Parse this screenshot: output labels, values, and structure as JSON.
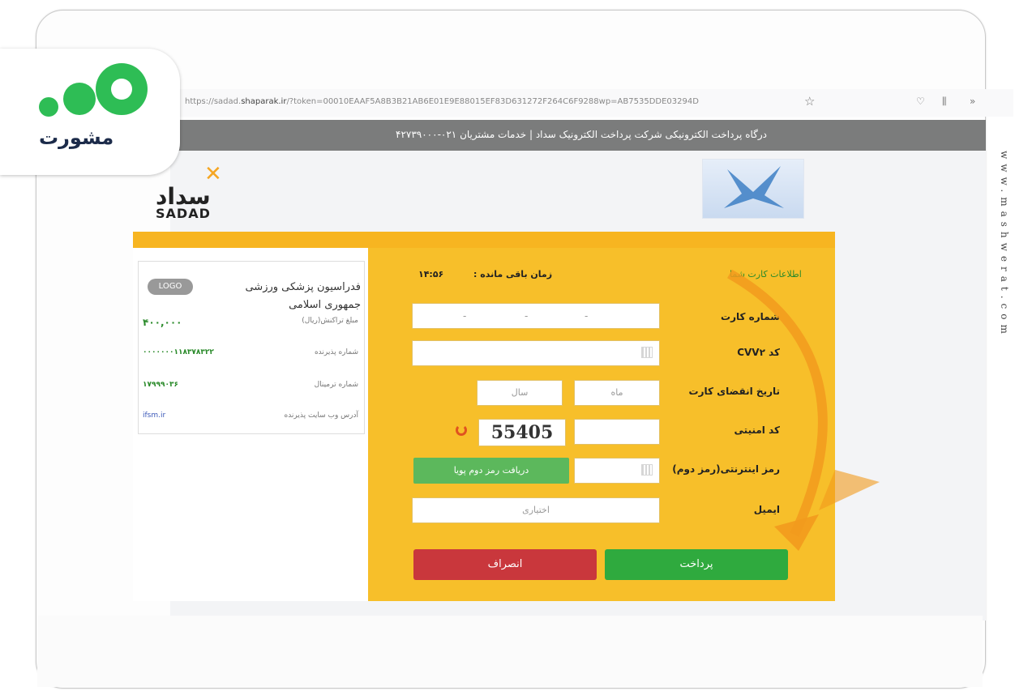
{
  "browser": {
    "url_prefix": "https://sadad.",
    "url_host": "shaparak.ir",
    "url_rest": "/?token=00010EAAF5A8B3B21AB6E01E9E88015EF83D631272F264C6F9288wp=AB7535DDE03294D",
    "toolbar_icons": [
      "star-icon",
      "pocket-icon",
      "library-icon",
      "overflow-icon"
    ]
  },
  "banner": {
    "text": "درگاه پرداخت الکترونیکی شرکت پرداخت الکترونیک سداد | خدمات مشتریان ۰۲۱-۴۲۷۳۹۰۰۰"
  },
  "logos": {
    "sadad_fa": "سداد",
    "sadad_en": "SADAD"
  },
  "merchant": {
    "logo_label": "LOGO",
    "name": "فدراسیون پزشکی ورزشی جمهوری اسلامی",
    "rows": [
      {
        "label": "مبلغ تراکنش(ریال)",
        "value": "۴۰۰,۰۰۰"
      },
      {
        "label": "شماره پذیرنده",
        "value": "۰۰۰۰۰۰۰۱۱۸۳۷۸۳۲۲"
      },
      {
        "label": "شماره ترمینال",
        "value": "۱۷۹۹۹۰۳۶"
      },
      {
        "label": "آدرس وب سایت پذیرنده",
        "value": "ifsm.ir"
      }
    ]
  },
  "form": {
    "section_title": "اطلاعات کارت شما",
    "timer_label": "زمان باقی مانده :",
    "timer_value": "۱۴:۵۶",
    "labels": {
      "card_number": "شماره کارت",
      "cvv2": "کد CVV۲",
      "expiry": "تاریخ انقضای کارت",
      "captcha": "کد امنیتی",
      "password": "رمز اینترنتی(رمز دوم)",
      "email": "ایمیل"
    },
    "card_number_dashes": [
      "-",
      "-",
      "-"
    ],
    "expiry_month_placeholder": "ماه",
    "expiry_year_placeholder": "سال",
    "captcha_text": "55405",
    "otp_button": "دریافت رمز دوم پویا",
    "email_placeholder": "اختیاری",
    "pay_button": "پرداخت",
    "cancel_button": "انصراف"
  },
  "watermark": {
    "logo_text": "مشورت",
    "vertical_text": "www.mashwerat.com"
  },
  "colors": {
    "banner": "#7b7c7c",
    "panel": "#f7bf2a",
    "pay": "#2faa3e",
    "cancel": "#c9373c",
    "otp": "#5cb85c",
    "watermark_green": "#2ebd55"
  }
}
